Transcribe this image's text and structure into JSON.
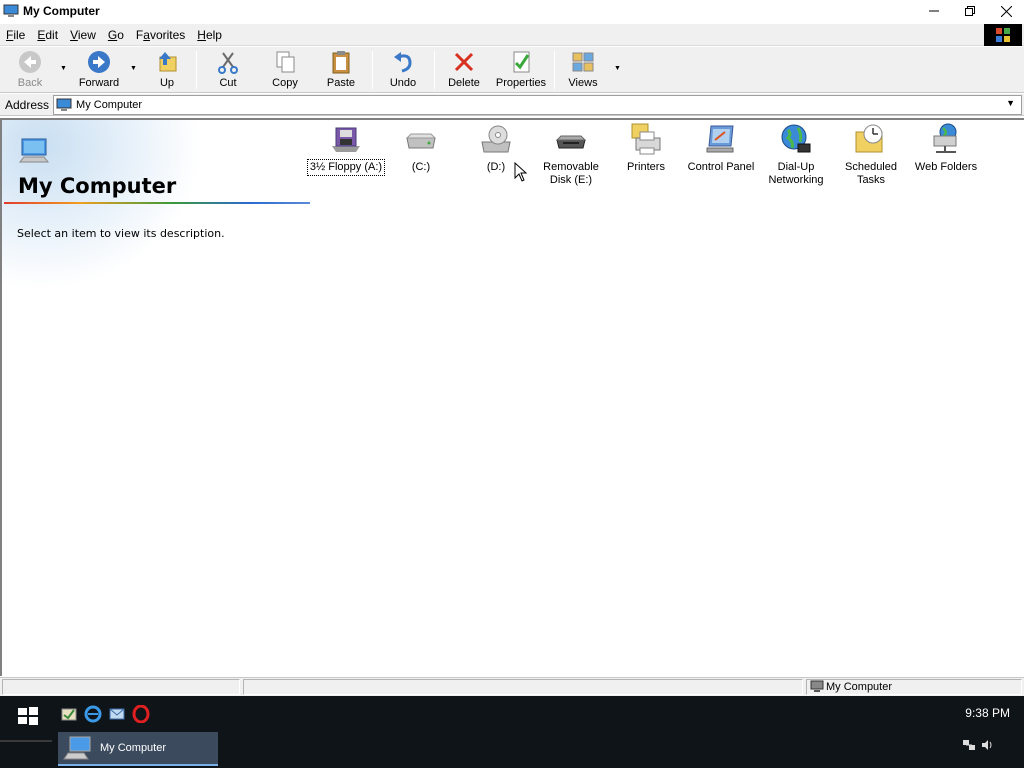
{
  "window": {
    "title": "My Computer",
    "buttons": [
      "minimize",
      "restore",
      "close"
    ]
  },
  "menu": {
    "items": [
      {
        "label": "File",
        "accel": "F"
      },
      {
        "label": "Edit",
        "accel": "E"
      },
      {
        "label": "View",
        "accel": "V"
      },
      {
        "label": "Go",
        "accel": "G"
      },
      {
        "label": "Favorites",
        "accel": "a"
      },
      {
        "label": "Help",
        "accel": "H"
      }
    ]
  },
  "toolbar": {
    "back": "Back",
    "forward": "Forward",
    "up": "Up",
    "cut": "Cut",
    "copy": "Copy",
    "paste": "Paste",
    "undo": "Undo",
    "delete": "Delete",
    "properties": "Properties",
    "views": "Views"
  },
  "address": {
    "label": "Address",
    "value": "My Computer"
  },
  "left_pane": {
    "title": "My Computer",
    "description": "Select an item to view its description."
  },
  "items": [
    {
      "label": "3½ Floppy (A:)",
      "icon": "floppy-drive-icon",
      "selected": true
    },
    {
      "label": "(C:)",
      "icon": "hard-drive-icon"
    },
    {
      "label": "(D:)",
      "icon": "cd-drive-icon"
    },
    {
      "label": "Removable Disk (E:)",
      "icon": "removable-disk-icon"
    },
    {
      "label": "Printers",
      "icon": "printers-folder-icon"
    },
    {
      "label": "Control Panel",
      "icon": "control-panel-icon"
    },
    {
      "label": "Dial-Up Networking",
      "icon": "dial-up-networking-icon"
    },
    {
      "label": "Scheduled Tasks",
      "icon": "scheduled-tasks-icon"
    },
    {
      "label": "Web Folders",
      "icon": "web-folders-icon"
    }
  ],
  "status_bar": {
    "zone": "My Computer"
  },
  "taskbar": {
    "task_label": "My Computer",
    "clock": "9:38 PM"
  },
  "colors": {
    "chrome": "#f0f0f0",
    "taskbar": "#0f1419",
    "task_active": "#3b4a5c",
    "accent": "#7ab0ea"
  }
}
